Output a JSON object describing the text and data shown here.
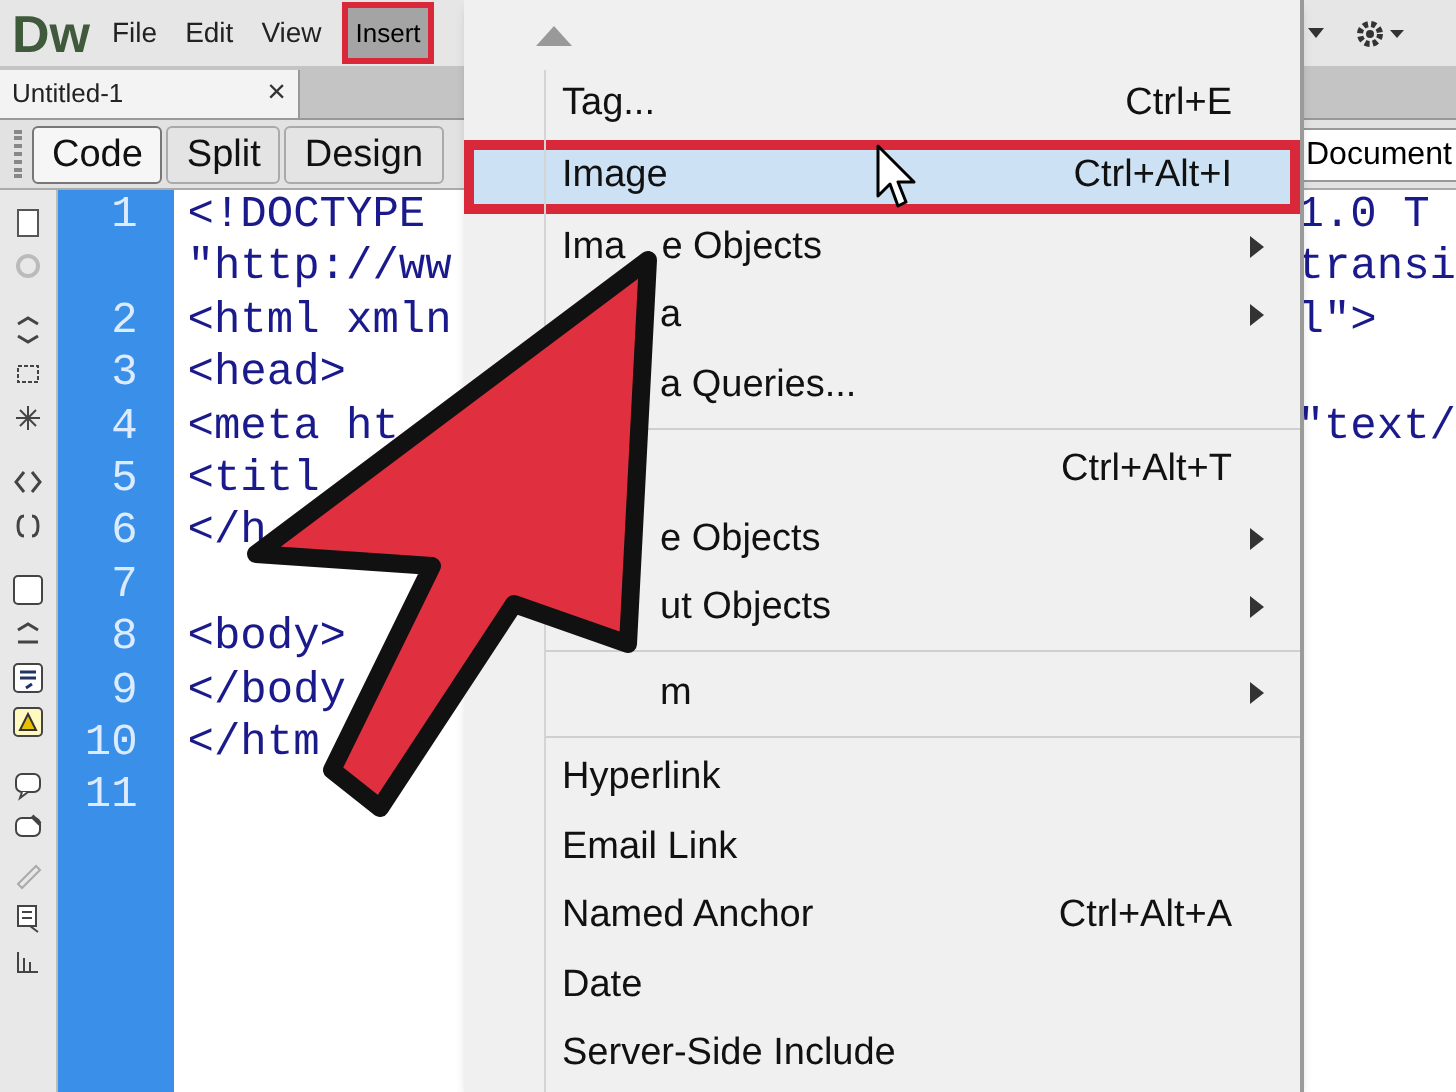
{
  "app": {
    "logo": "Dw",
    "menus": [
      {
        "label": "File",
        "selected": false
      },
      {
        "label": "Edit",
        "selected": false
      },
      {
        "label": "View",
        "selected": false
      },
      {
        "label": "Insert",
        "selected": true
      }
    ]
  },
  "document_tab": {
    "title": "Untitled-1",
    "close": "×"
  },
  "view_buttons": [
    {
      "label": "Code",
      "selected": true
    },
    {
      "label": "Split",
      "selected": false
    },
    {
      "label": "Design",
      "selected": false
    }
  ],
  "title_field": {
    "value": "Document"
  },
  "editor": {
    "lines": [
      {
        "number": "1",
        "left": "<!DOCTYPE",
        "right": "1.0 T"
      },
      {
        "left": "\"http://ww",
        "right": "transi"
      },
      {
        "number": "2",
        "left": "<html xmln",
        "right": "l\">"
      },
      {
        "number": "3",
        "left": "<head>"
      },
      {
        "number": "4",
        "left": "<meta ht",
        "right": "\"text/"
      },
      {
        "number": "5",
        "left": "<titl"
      },
      {
        "number": "6",
        "left": "</h"
      },
      {
        "number": "7"
      },
      {
        "number": "8",
        "left": "<body>"
      },
      {
        "number": "9",
        "left": "</body"
      },
      {
        "number": "10",
        "left": "</htm"
      },
      {
        "number": "11"
      }
    ]
  },
  "insert_menu": {
    "items": [
      {
        "kind": "item",
        "label_parts": [
          "Tag..."
        ],
        "shortcut": "Ctrl+E",
        "submenu": false,
        "selected": false
      },
      {
        "kind": "item",
        "label_parts": [
          "Image"
        ],
        "shortcut": "Ctrl+Alt+I",
        "submenu": false,
        "selected": true
      },
      {
        "kind": "item",
        "label_parts": [
          "Ima",
          "e Objects"
        ],
        "submenu": true,
        "selected": false
      },
      {
        "kind": "item",
        "label_parts": [
          "a"
        ],
        "submenu": true,
        "selected": false
      },
      {
        "kind": "item",
        "label_parts": [
          "a Queries..."
        ],
        "submenu": false,
        "selected": false
      },
      {
        "kind": "separator"
      },
      {
        "kind": "item",
        "shortcut": "Ctrl+Alt+T",
        "submenu": false,
        "selected": false
      },
      {
        "kind": "item",
        "label_parts": [
          "e Objects"
        ],
        "submenu": true,
        "selected": false
      },
      {
        "kind": "item",
        "label_parts": [
          "ut Objects"
        ],
        "submenu": true,
        "selected": false
      },
      {
        "kind": "separator"
      },
      {
        "kind": "item",
        "label_parts": [
          "m"
        ],
        "submenu": true,
        "selected": false
      },
      {
        "kind": "separator"
      },
      {
        "kind": "item",
        "label_parts": [
          "Hyperlink"
        ],
        "submenu": false,
        "selected": false
      },
      {
        "kind": "item",
        "label_parts": [
          "Email Link"
        ],
        "submenu": false,
        "selected": false
      },
      {
        "kind": "item",
        "label_parts": [
          "Named Anchor"
        ],
        "shortcut": "Ctrl+Alt+A",
        "submenu": false,
        "selected": false
      },
      {
        "kind": "item",
        "label_parts": [
          "Date"
        ],
        "submenu": false,
        "selected": false
      },
      {
        "kind": "item",
        "label_parts": [
          "Server-Side Include"
        ],
        "submenu": false,
        "selected": false
      }
    ]
  }
}
